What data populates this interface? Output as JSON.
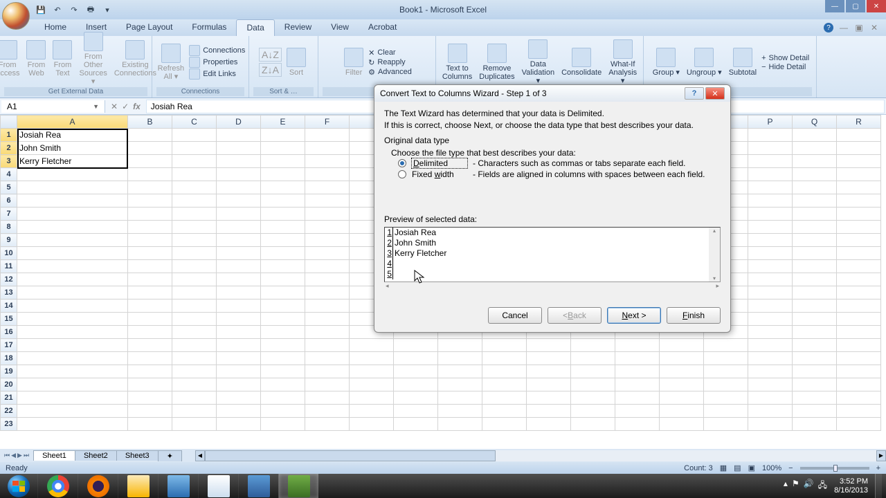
{
  "window": {
    "title": "Book1 - Microsoft Excel"
  },
  "tabs": [
    "Home",
    "Insert",
    "Page Layout",
    "Formulas",
    "Data",
    "Review",
    "View",
    "Acrobat"
  ],
  "active_tab": 4,
  "ribbon": {
    "get_external": {
      "label": "Get External Data",
      "items": [
        "From Access",
        "From Web",
        "From Text",
        "From Other Sources ▾",
        "Existing Connections"
      ]
    },
    "connections": {
      "label": "Connections",
      "refresh": "Refresh All ▾",
      "links": [
        "Connections",
        "Properties",
        "Edit Links"
      ]
    },
    "sort_filter": {
      "label": "Sort & …",
      "sort": "Sort",
      "filter": "Filter",
      "opts": [
        "Clear",
        "Reapply",
        "Advanced"
      ]
    },
    "data_tools": {
      "items": [
        "Text to Columns",
        "Remove Duplicates",
        "Data Validation ▾",
        "Consolidate",
        "What-If Analysis ▾"
      ]
    },
    "outline": {
      "items": [
        "Group ▾",
        "Ungroup ▾",
        "Subtotal"
      ],
      "detail": [
        "Show Detail",
        "Hide Detail"
      ]
    }
  },
  "namebox": "A1",
  "formula": "Josiah Rea",
  "columns": [
    "A",
    "B",
    "C",
    "D",
    "E",
    "F",
    "",
    "",
    "",
    "",
    "",
    "",
    "",
    "",
    "",
    "P",
    "Q",
    "R"
  ],
  "rows": 23,
  "cells": {
    "r1": "Josiah Rea",
    "r2": "John Smith",
    "r3": "Kerry Fletcher"
  },
  "dialog": {
    "title": "Convert Text to Columns Wizard - Step 1 of 3",
    "line1": "The Text Wizard has determined that your data is Delimited.",
    "line2": "If this is correct, choose Next, or choose the data type that best describes your data.",
    "group_label": "Original data type",
    "choose_label": "Choose the file type that best describes your data:",
    "opt_delimited": "Delimited",
    "opt_delimited_desc": "- Characters such as commas or tabs separate each field.",
    "opt_fixed": "Fixed width",
    "opt_fixed_desc": "- Fields are aligned in columns with spaces between each field.",
    "preview_label": "Preview of selected data:",
    "preview": [
      {
        "n": "1",
        "t": "Josiah Rea"
      },
      {
        "n": "2",
        "t": "John Smith"
      },
      {
        "n": "3",
        "t": "Kerry Fletcher"
      },
      {
        "n": "4",
        "t": ""
      },
      {
        "n": "5",
        "t": ""
      }
    ],
    "btn_cancel": "Cancel",
    "btn_back": "< Back",
    "btn_next": "Next >",
    "btn_finish": "Finish"
  },
  "sheets": [
    "Sheet1",
    "Sheet2",
    "Sheet3"
  ],
  "status": {
    "ready": "Ready",
    "count": "Count: 3",
    "zoom": "100%"
  },
  "tray": {
    "time": "3:52 PM",
    "date": "8/16/2013"
  }
}
